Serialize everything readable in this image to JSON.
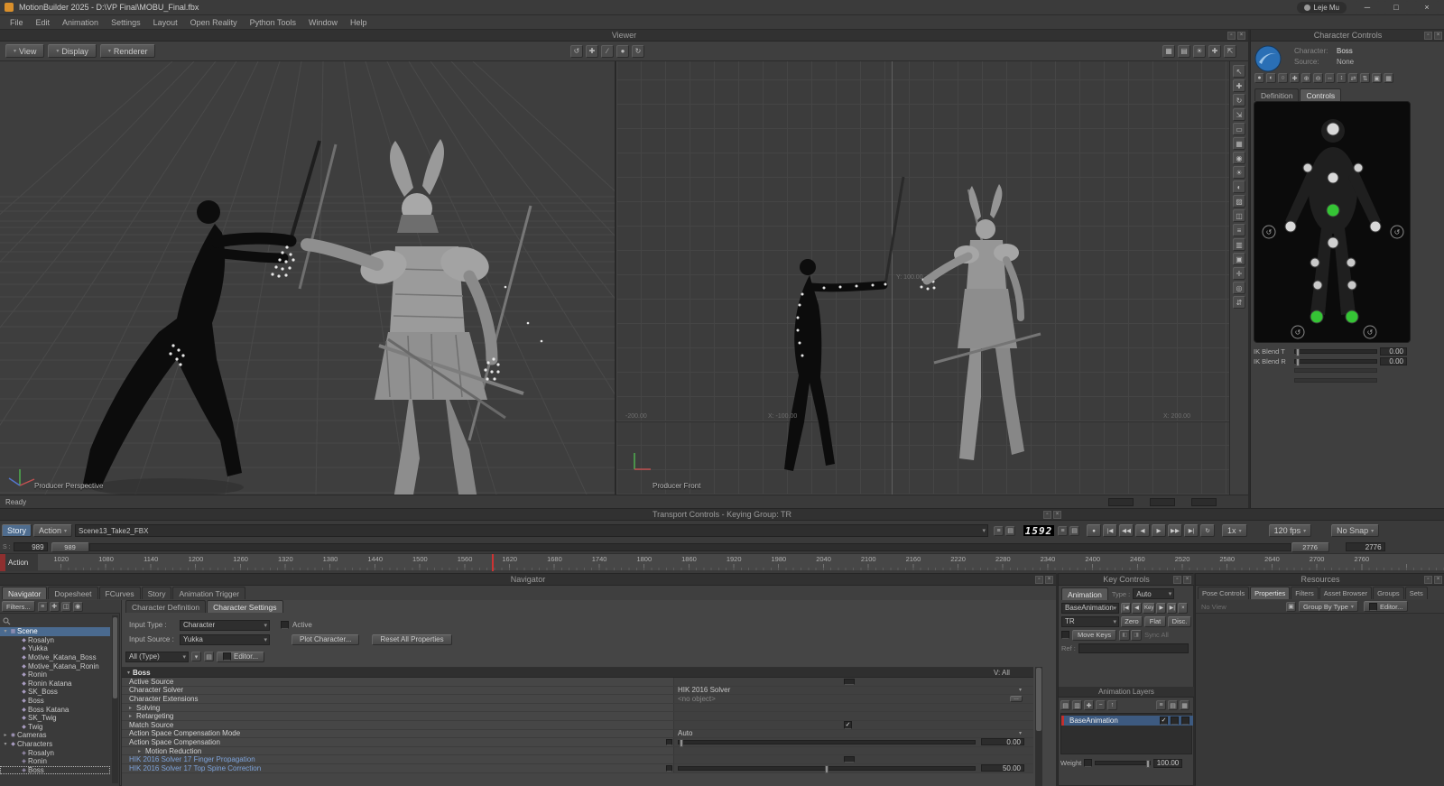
{
  "window": {
    "title": "MotionBuilder 2025 - D:\\VP Final\\MOBU_Final.fbx",
    "user": "Leje Mu",
    "minimize": "─",
    "maximize": "□",
    "close": "×"
  },
  "menu": [
    "File",
    "Edit",
    "Animation",
    "Settings",
    "Layout",
    "Open Reality",
    "Python Tools",
    "Window",
    "Help"
  ],
  "viewer": {
    "title": "Viewer",
    "view_button": "View",
    "display_button": "Display",
    "renderer_button": "Renderer",
    "center_tools": [
      {
        "name": "orbit-tool-icon",
        "glyph": "↺"
      },
      {
        "name": "pan-tool-icon",
        "glyph": "✚"
      },
      {
        "name": "zoom-tool-icon",
        "glyph": "∕"
      },
      {
        "name": "camera-sphere-icon",
        "glyph": "●"
      },
      {
        "name": "turntable-tool-icon",
        "glyph": "↻"
      }
    ],
    "right_tools": [
      {
        "name": "display-mode-icon",
        "glyph": "▦"
      },
      {
        "name": "wireframe-icon",
        "glyph": "▤"
      },
      {
        "name": "lighting-icon",
        "glyph": "☀"
      },
      {
        "name": "gizmo-toggle-icon",
        "glyph": "✚"
      },
      {
        "name": "maximize-viewport-icon",
        "glyph": "⇱"
      }
    ],
    "side_tools": [
      {
        "name": "select-tool-icon",
        "glyph": "↖"
      },
      {
        "name": "translate-tool-icon",
        "glyph": "✚"
      },
      {
        "name": "rotate-tool-icon",
        "glyph": "↻"
      },
      {
        "name": "scale-tool-icon",
        "glyph": "⇲"
      },
      {
        "name": "frame-tool-icon",
        "glyph": "▭"
      },
      {
        "name": "grid-tool-icon",
        "glyph": "▦"
      },
      {
        "name": "camera-tool-icon",
        "glyph": "◉"
      },
      {
        "name": "light-tool-icon",
        "glyph": "☀"
      },
      {
        "name": "shading-tool-icon",
        "glyph": "◐"
      },
      {
        "name": "texture-tool-icon",
        "glyph": "▨"
      },
      {
        "name": "xray-tool-icon",
        "glyph": "◫"
      },
      {
        "name": "list-tool-icon",
        "glyph": "≡"
      },
      {
        "name": "layers-tool-icon",
        "glyph": "▥"
      },
      {
        "name": "safe-area-icon",
        "glyph": "▣"
      },
      {
        "name": "axis-tool-icon",
        "glyph": "✛"
      },
      {
        "name": "target-tool-icon",
        "glyph": "◎"
      },
      {
        "name": "swap-tool-icon",
        "glyph": "⇵"
      }
    ],
    "perspective_label": "Producer Perspective",
    "front_label": "Producer Front",
    "front_grid_labels": [
      "-200.00",
      "X: -100.00",
      "Y: 100.00",
      "X: 200.00"
    ],
    "status": "Ready"
  },
  "character_controls": {
    "title": "Character Controls",
    "character_label": "Character:",
    "character_value": "Boss",
    "source_label": "Source:",
    "source_value": "None",
    "icon_tools": [
      {
        "name": "full-body-icon",
        "glyph": "●"
      },
      {
        "name": "body-part-icon",
        "glyph": "◐"
      },
      {
        "name": "selection-icon",
        "glyph": "○"
      },
      {
        "name": "translate-icon",
        "glyph": "✚"
      },
      {
        "name": "plus-icon",
        "glyph": "⊕"
      },
      {
        "name": "minus-icon",
        "glyph": "⊖"
      },
      {
        "name": "mirror-h-icon",
        "glyph": "↔"
      },
      {
        "name": "mirror-v-icon",
        "glyph": "↕"
      },
      {
        "name": "swap-icon",
        "glyph": "⇄"
      },
      {
        "name": "flip-icon",
        "glyph": "⇅"
      },
      {
        "name": "pose-icon",
        "glyph": "▣"
      },
      {
        "name": "grid-icon",
        "glyph": "▦"
      }
    ],
    "tabs": [
      {
        "label": "Definition"
      },
      {
        "label": "Controls",
        "active": true
      }
    ],
    "sliders": [
      {
        "label": "IK Blend T",
        "value": "0.00"
      },
      {
        "label": "IK Blend R",
        "value": "0.00"
      }
    ]
  },
  "transport": {
    "title": "Transport Controls - Keying Group: TR",
    "story_button": "Story",
    "action_button": "Action",
    "take_value": "Scene13_Take2_FBX",
    "frame_display": "1592",
    "lcd_side_icons": [
      {
        "name": "list-view-icon",
        "glyph": "≡"
      },
      {
        "name": "table-view-icon",
        "glyph": "▤"
      }
    ],
    "playback": [
      {
        "name": "record-button",
        "glyph": "●"
      },
      {
        "name": "go-to-start-button",
        "glyph": "|◀"
      },
      {
        "name": "previous-key-button",
        "glyph": "◀◀"
      },
      {
        "name": "step-back-button",
        "glyph": "◀"
      },
      {
        "name": "play-button",
        "glyph": "▶"
      },
      {
        "name": "step-forward-button",
        "glyph": "▶▶"
      },
      {
        "name": "go-to-end-button",
        "glyph": "▶|"
      },
      {
        "name": "loop-button",
        "glyph": "↻"
      }
    ],
    "speed_value": "1x",
    "fps_value": "120 fps",
    "snap_value": "No Snap",
    "s_label": "S :",
    "range_start": "989",
    "zoom_start": "989",
    "zoom_end": "2776",
    "range_end": "2776",
    "action_label": "Action",
    "ruler": [
      "1020",
      "1080",
      "1140",
      "1200",
      "1260",
      "1320",
      "1380",
      "1440",
      "1500",
      "1560",
      "1620",
      "1680",
      "1740",
      "1800",
      "1860",
      "1920",
      "1980",
      "2040",
      "2100",
      "2160",
      "2220",
      "2280",
      "2340",
      "2400",
      "2460",
      "2520",
      "2580",
      "2640",
      "2700",
      "2760"
    ]
  },
  "navigator": {
    "title": "Navigator",
    "tabs": [
      {
        "label": "Navigator",
        "active": true
      },
      {
        "label": "Dopesheet"
      },
      {
        "label": "FCurves"
      },
      {
        "label": "Story"
      },
      {
        "label": "Animation Trigger"
      }
    ],
    "filters_label": "Filters...",
    "filter_icons": [
      {
        "name": "filter-list-icon",
        "glyph": "≡"
      },
      {
        "name": "filter-add-icon",
        "glyph": "✚"
      },
      {
        "name": "filter-split-icon",
        "glyph": "◫"
      },
      {
        "name": "filter-target-icon",
        "glyph": "◉"
      }
    ],
    "tree": [
      {
        "label": "Scene",
        "arrow": "▾",
        "icon": "▦",
        "selected": true
      },
      {
        "label": "Rosalyn",
        "icon": "◆",
        "depth": 1
      },
      {
        "label": "Yukka",
        "icon": "◆",
        "depth": 1
      },
      {
        "label": "Motive_Katana_Boss",
        "icon": "◆",
        "depth": 1
      },
      {
        "label": "Motive_Katana_Ronin",
        "icon": "◆",
        "depth": 1
      },
      {
        "label": "Ronin",
        "icon": "◆",
        "depth": 1
      },
      {
        "label": "Ronin Katana",
        "icon": "◆",
        "depth": 1
      },
      {
        "label": "SK_Boss",
        "icon": "◆",
        "depth": 1
      },
      {
        "label": "Boss",
        "icon": "◆",
        "depth": 1
      },
      {
        "label": "Boss Katana",
        "icon": "◆",
        "depth": 1
      },
      {
        "label": "SK_Twig",
        "icon": "◆",
        "depth": 1
      },
      {
        "label": "Twig",
        "icon": "◆",
        "depth": 1
      },
      {
        "label": "Cameras",
        "arrow": "▸",
        "icon": "◉"
      },
      {
        "label": "Characters",
        "arrow": "▾",
        "icon": "◆"
      },
      {
        "label": "Rosalyn",
        "icon": "◈",
        "depth": 1
      },
      {
        "label": "Ronin",
        "icon": "◈",
        "depth": 1
      },
      {
        "label": "Boss",
        "icon": "◈",
        "depth": 1,
        "focused": true
      }
    ]
  },
  "character_definition": {
    "tabs": [
      {
        "label": "Character Definition"
      },
      {
        "label": "Character Settings",
        "active": true
      }
    ],
    "input_type_label": "Input Type :",
    "input_type_value": "Character",
    "active_label": "Active",
    "input_source_label": "Input Source :",
    "input_source_value": "Yukka",
    "plot_button": "Plot Character...",
    "reset_button": "Reset All Properties",
    "filter_value": "All (Type)",
    "editor_button": "Editor...",
    "table_title": "Boss",
    "visibility_label": "V: All",
    "rows": [
      {
        "name": "Active Source"
      },
      {
        "name": "Character Solver",
        "value": "HIK 2016 Solver"
      },
      {
        "name": "Character Extensions",
        "value": "<no object>"
      },
      {
        "name": "Solving"
      },
      {
        "name": "Retargeting"
      },
      {
        "name": "Match Source"
      },
      {
        "name": "Action Space Compensation Mode",
        "value": "Auto"
      },
      {
        "name": "Action Space Compensation",
        "value": "0.00"
      },
      {
        "name": "Motion Reduction"
      },
      {
        "name": "HIK 2016 Solver 17 Finger Propagation"
      },
      {
        "name": "HIK 2016 Solver 17 Top Spine Correction",
        "value": "50.00"
      }
    ]
  },
  "key_controls": {
    "title": "Key Controls",
    "animation_tab": "Animation",
    "type_label": "Type :",
    "type_value": "Auto",
    "layer_value": "BaseAnimation",
    "nav_buttons": [
      {
        "name": "key-jump-start-button",
        "glyph": "|◀"
      },
      {
        "name": "key-prev-button",
        "glyph": "◀"
      },
      {
        "name": "key-button",
        "glyph": "Key"
      },
      {
        "name": "key-next-button",
        "glyph": "▶"
      },
      {
        "name": "key-jump-end-button",
        "glyph": "▶|"
      },
      {
        "name": "key-delete-button",
        "glyph": "×"
      }
    ],
    "filter_value": "TR",
    "zero_button": "Zero",
    "flat_button": "Flat",
    "disc_button": "Disc.",
    "move_keys_button": "Move Keys",
    "option_buttons": [
      {
        "name": "key-option-left-icon",
        "glyph": "◧"
      },
      {
        "name": "key-option-right-icon",
        "glyph": "◨"
      }
    ],
    "sync_all_label": "Sync All",
    "ref_label": "Ref :"
  },
  "animation_layers": {
    "title": "Animation Layers",
    "toolbar_left": [
      {
        "name": "new-layer-icon",
        "glyph": "▤"
      },
      {
        "name": "duplicate-layer-icon",
        "glyph": "▥"
      },
      {
        "name": "add-layer-icon",
        "glyph": "✚"
      },
      {
        "name": "remove-layer-icon",
        "glyph": "−"
      },
      {
        "name": "merge-layer-icon",
        "glyph": "↑"
      }
    ],
    "toolbar_right": [
      {
        "name": "layer-list-icon",
        "glyph": "≡"
      },
      {
        "name": "layer-detail-icon",
        "glyph": "▤"
      },
      {
        "name": "layer-grid-icon",
        "glyph": "▦"
      }
    ],
    "layer_name": "BaseAnimation",
    "weight_label": "Weight",
    "weight_value": "100.00"
  },
  "resources": {
    "title": "Resources",
    "tabs": [
      {
        "label": "Pose Controls"
      },
      {
        "label": "Properties",
        "active": true
      },
      {
        "label": "Filters"
      },
      {
        "label": "Asset Browser"
      },
      {
        "label": "Groups"
      },
      {
        "label": "Sets"
      }
    ],
    "no_view_label": "No View",
    "group_by_value": "Group By Type",
    "editor_button": "Editor..."
  }
}
